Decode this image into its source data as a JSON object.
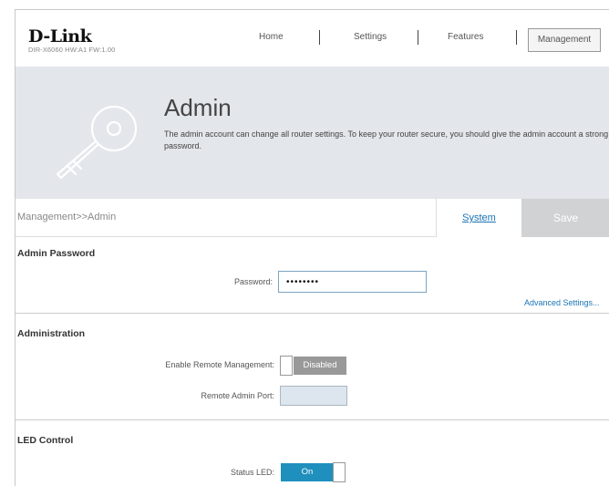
{
  "header": {
    "brand": "D-Link",
    "model": "DIR-X6060 HW:A1 FW:1.00",
    "nav": [
      "Home",
      "Settings",
      "Features",
      "Management"
    ],
    "active_nav": "Management"
  },
  "banner": {
    "title": "Admin",
    "description": "The admin account can change all router settings. To keep your router secure, you should give the admin account a strong password."
  },
  "toolbar": {
    "breadcrumb": "Management>>Admin",
    "system_label": "System",
    "save_label": "Save"
  },
  "admin_password": {
    "title": "Admin Password",
    "password_label": "Password:",
    "password_value": "••••••••",
    "advanced_link": "Advanced Settings..."
  },
  "administration": {
    "title": "Administration",
    "remote_mgmt_label": "Enable Remote Management:",
    "remote_mgmt_state": "Disabled",
    "remote_port_label": "Remote Admin Port:"
  },
  "led_control": {
    "title": "LED Control",
    "status_led_label": "Status LED:",
    "status_led_state": "On"
  },
  "colors": {
    "accent": "#1a74b6",
    "toggle_on": "#1f8fbd",
    "toggle_off": "#999999",
    "banner_bg": "#e3e6ea",
    "save_bg": "#d1d2d4"
  }
}
